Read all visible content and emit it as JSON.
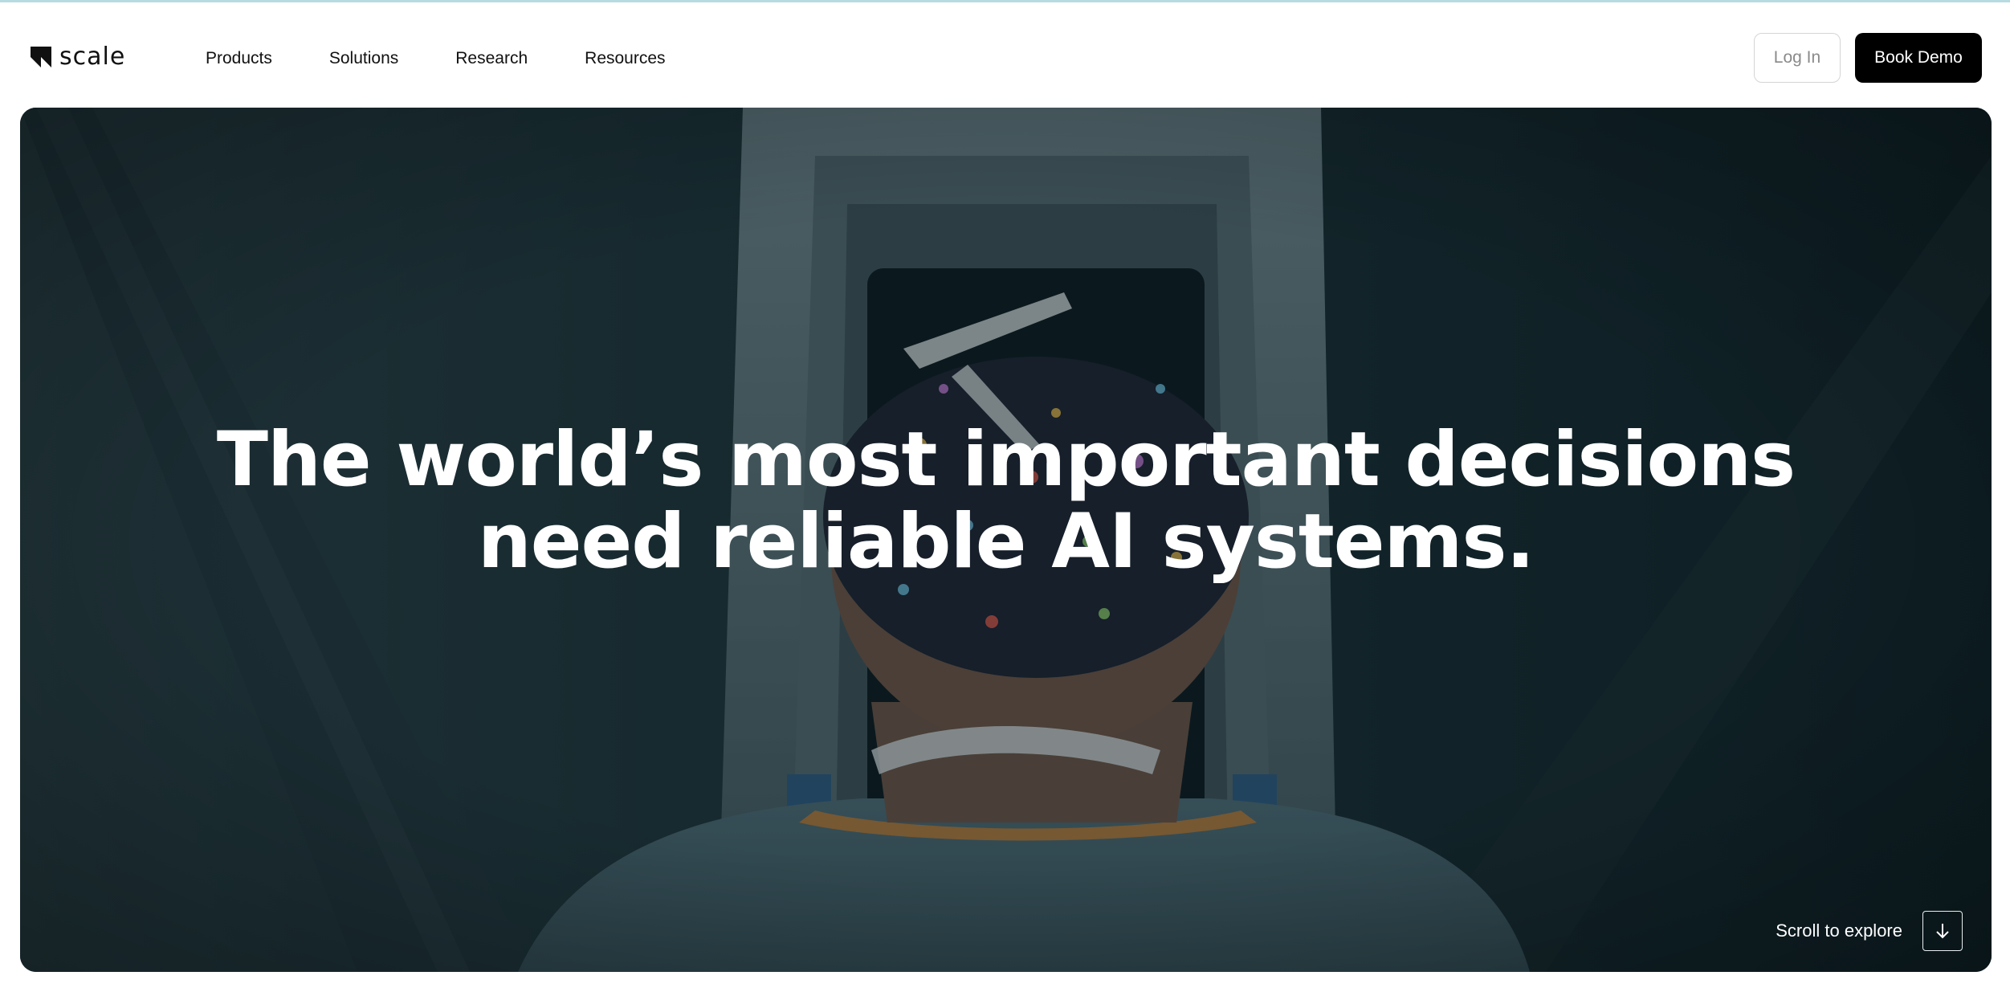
{
  "brand": {
    "name": "scale",
    "logo_icon": "scale-mark-icon"
  },
  "nav": {
    "items": [
      {
        "label": "Products"
      },
      {
        "label": "Solutions"
      },
      {
        "label": "Research"
      },
      {
        "label": "Resources"
      }
    ]
  },
  "actions": {
    "login_label": "Log In",
    "demo_label": "Book Demo"
  },
  "hero": {
    "title_line1": "The world’s most important decisions",
    "title_line2": "need reliable AI systems.",
    "scroll_label": "Scroll to explore",
    "scroll_icon": "arrow-down-icon"
  },
  "colors": {
    "primary_button": "#000000",
    "hero_overlay": "#132a30",
    "top_rule": "#b7dbe0"
  }
}
